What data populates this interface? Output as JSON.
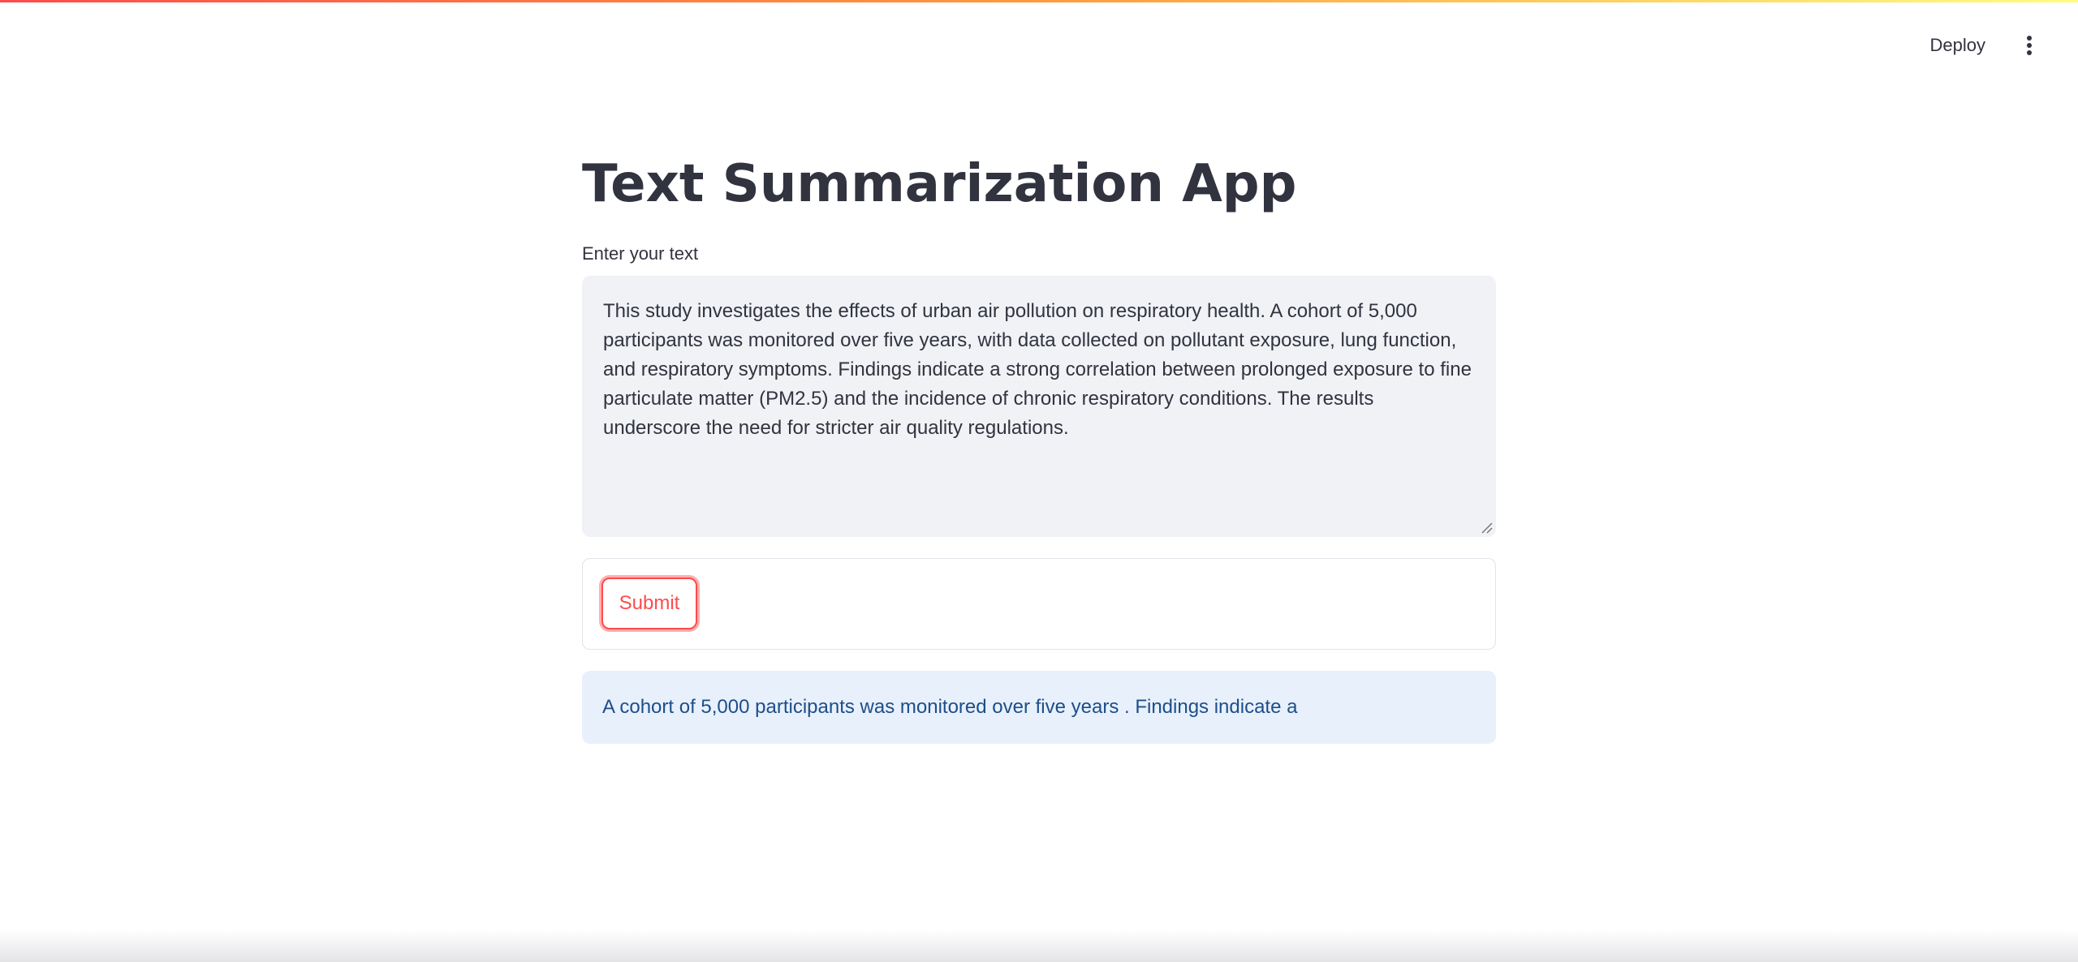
{
  "header": {
    "deploy_label": "Deploy",
    "menu_icon": "kebab-menu-icon"
  },
  "main": {
    "title": "Text Summarization App",
    "input": {
      "label": "Enter your text",
      "value": "This study investigates the effects of urban air pollution on respiratory health. A cohort of 5,000 participants was monitored over five years, with data collected on pollutant exposure, lung function, and respiratory symptoms. Findings indicate a strong correlation between prolonged exposure to fine particulate matter (PM2.5) and the incidence of chronic respiratory conditions. The results underscore the need for stricter air quality regulations."
    },
    "submit_label": "Submit",
    "result_text": "A cohort of 5,000 participants was monitored over five years . Findings indicate a"
  },
  "colors": {
    "accent": "#ff4b4b",
    "text": "#31333f",
    "input_bg": "#f0f2f6",
    "result_bg": "#e8f0fb",
    "result_text": "#1d4e89"
  }
}
